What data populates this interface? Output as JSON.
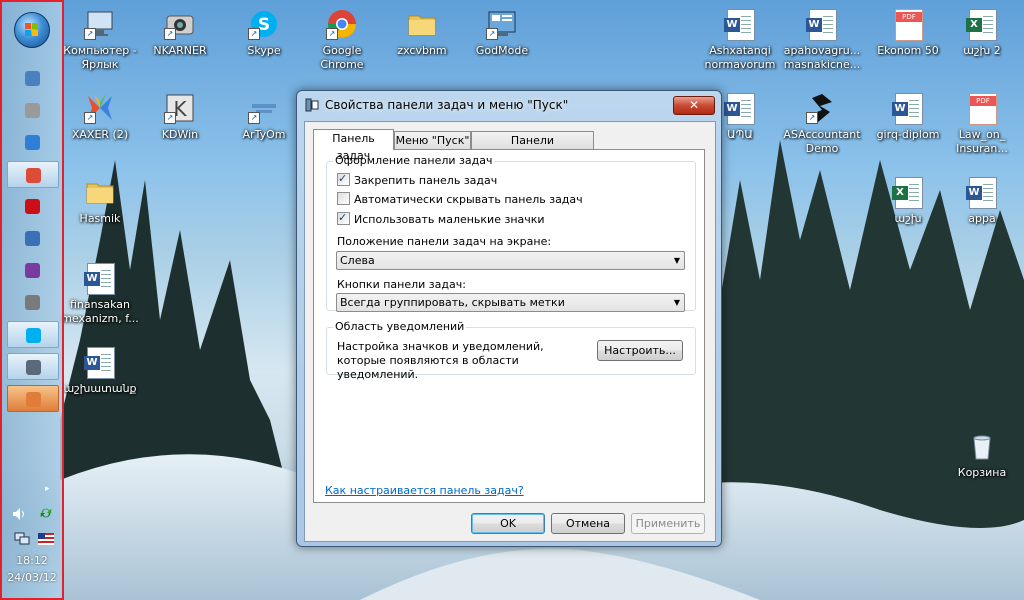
{
  "taskbar": {
    "start_label": "Start",
    "items": [
      {
        "name": "taskbar-item-app1",
        "icon": "puzzle-icon",
        "color": "#4a7fc0"
      },
      {
        "name": "taskbar-item-kdwin",
        "icon": "kdwin-icon",
        "color": "#9a9a9a"
      },
      {
        "name": "taskbar-item-ie",
        "icon": "internet-explorer-icon",
        "color": "#2f7ed8"
      },
      {
        "name": "taskbar-item-chrome",
        "icon": "chrome-icon",
        "color": "#dd4b39"
      },
      {
        "name": "taskbar-item-opera",
        "icon": "opera-icon",
        "color": "#cc0f16"
      },
      {
        "name": "taskbar-item-keyboard",
        "icon": "keyboard-icon",
        "color": "#3b6fb6"
      },
      {
        "name": "taskbar-item-messenger",
        "icon": "messenger-icon",
        "color": "#7b3aa0"
      },
      {
        "name": "taskbar-item-window",
        "icon": "window-icon",
        "color": "#7a7a7a"
      },
      {
        "name": "taskbar-item-skype",
        "icon": "skype-icon",
        "color": "#00aff0"
      },
      {
        "name": "taskbar-item-taskbar-props",
        "icon": "taskbar-properties-icon",
        "color": "#5a6a7a"
      },
      {
        "name": "taskbar-item-paint",
        "icon": "paint-icon",
        "color": "#e07d3a"
      }
    ],
    "clock_time": "18:12",
    "clock_date": "24/03/12"
  },
  "desktop_icons": [
    {
      "label": "Компьютер -\nЯрлык",
      "icon": "computer-icon"
    },
    {
      "label": "NKARNER",
      "icon": "camera-icon"
    },
    {
      "label": "Skype",
      "icon": "skype-icon"
    },
    {
      "label": "Google\nChrome",
      "icon": "chrome-icon"
    },
    {
      "label": "zxcvbnm",
      "icon": "folder-icon"
    },
    {
      "label": "GodMode",
      "icon": "control-panel-icon"
    },
    {
      "label": "Ashxatanqi\nnormavorum",
      "icon": "word-doc-icon"
    },
    {
      "label": "apahovagru...\nmasnakicne...",
      "icon": "word-doc-icon"
    },
    {
      "label": "Ekonom 50",
      "icon": "pdf-icon"
    },
    {
      "label": "աշխ 2",
      "icon": "excel-icon"
    },
    {
      "label": "XAXER (2)",
      "icon": "butterfly-icon"
    },
    {
      "label": "KDWin",
      "icon": "kdwin-icon"
    },
    {
      "label": "ArTyOm",
      "icon": "network-icon"
    },
    {
      "label": "ԱՊԱ",
      "icon": "word-doc-icon"
    },
    {
      "label": "ASAccountant\nDemo",
      "icon": "asaccountant-icon"
    },
    {
      "label": "girq-diplom",
      "icon": "word-doc-icon"
    },
    {
      "label": "Law_on_\nInsuran...",
      "icon": "pdf-icon"
    },
    {
      "label": "Hasmik",
      "icon": "user-folder-icon"
    },
    {
      "label": "աշխ",
      "icon": "excel-icon"
    },
    {
      "label": "appa",
      "icon": "word-doc-icon"
    },
    {
      "label": "finansakan\nmexanizm, f...",
      "icon": "word-doc-icon"
    },
    {
      "label": "աշխատանք",
      "icon": "word-doc-icon"
    },
    {
      "label": "Корзина",
      "icon": "recycle-bin-icon"
    }
  ],
  "dialog": {
    "title": "Свойства панели задач и меню \"Пуск\"",
    "close_label": "✕",
    "tabs": [
      "Панель задач",
      "Меню \"Пуск\"",
      "Панели инструментов"
    ],
    "appearance_group": "Оформление панели задач",
    "checkboxes": [
      {
        "label": "Закрепить панель задач",
        "checked": true
      },
      {
        "label": "Автоматически скрывать панель задач",
        "checked": false
      },
      {
        "label": "Использовать маленькие значки",
        "checked": true
      }
    ],
    "position_label": "Положение панели задач на экране:",
    "position_value": "Слева",
    "buttons_label": "Кнопки панели задач:",
    "buttons_value": "Всегда группировать, скрывать метки",
    "notify_group": "Область уведомлений",
    "notify_text": "Настройка значков и уведомлений, которые появляются в области уведомлений.",
    "customize_label": "Настроить...",
    "help_link": "Как настраивается панель задач?",
    "ok_label": "OK",
    "cancel_label": "Отмена",
    "apply_label": "Применить"
  }
}
